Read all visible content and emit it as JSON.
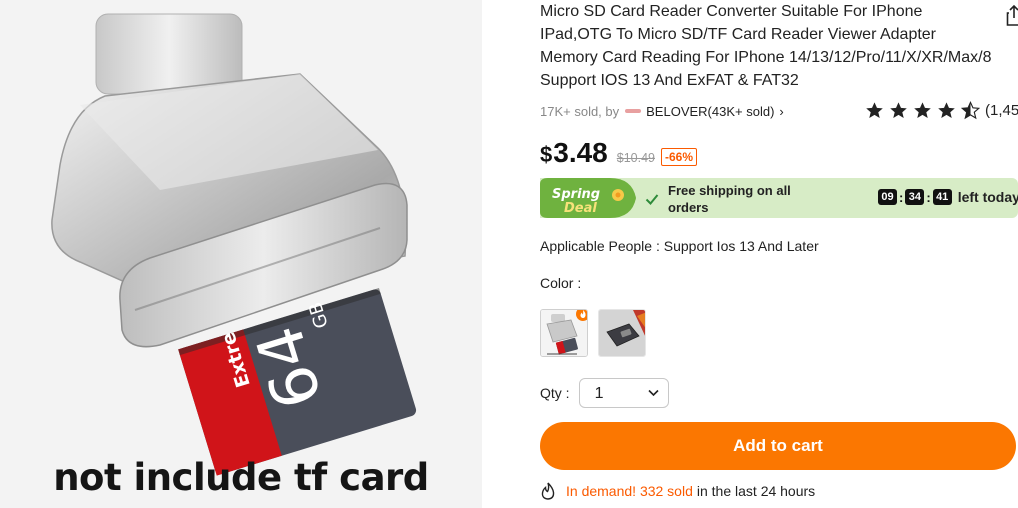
{
  "product_image": {
    "caption": "not include tf card",
    "card_brand_text": "Extre",
    "card_capacity_text": "64",
    "card_unit_text": "GB"
  },
  "product": {
    "title": "Micro SD Card Reader Converter Suitable For IPhone IPad,OTG To Micro SD/TF Card Reader Viewer Adapter Memory Card Reading For IPhone 14/13/12/Pro/11/X/XR/Max/8 Support IOS 13 And ExFAT & FAT32",
    "sold_text": "17K+ sold, by",
    "store_name": "BELOVER(43K+ sold)",
    "store_chevron": "›",
    "rating_stars": 4.5,
    "rating_count": "(1,45"
  },
  "price": {
    "currency": "$",
    "amount": "3.48",
    "original": "$10.49",
    "discount": "-66%"
  },
  "deal": {
    "badge_line1": "Spring",
    "badge_line2": "Deal",
    "shipping_text": "Free shipping on all orders",
    "timer_hours": "09",
    "timer_minutes": "34",
    "timer_seconds": "41",
    "timer_sep": ":",
    "timer_suffix": "left today"
  },
  "attributes": {
    "applicable": "Applicable People : Support Ios 13 And Later",
    "color_label": "Color :",
    "color_options": [
      "silver",
      "space gray"
    ]
  },
  "quantity": {
    "label": "Qty :",
    "value": "1"
  },
  "actions": {
    "add_to_cart": "Add to cart"
  },
  "demand": {
    "highlight": "In demand! 332 sold",
    "rest": "in the last 24 hours"
  },
  "colors": {
    "accent": "#fb7701",
    "discount": "#fb5a00",
    "deal_bg": "#d7ecc6",
    "check": "#2e8b3a"
  }
}
